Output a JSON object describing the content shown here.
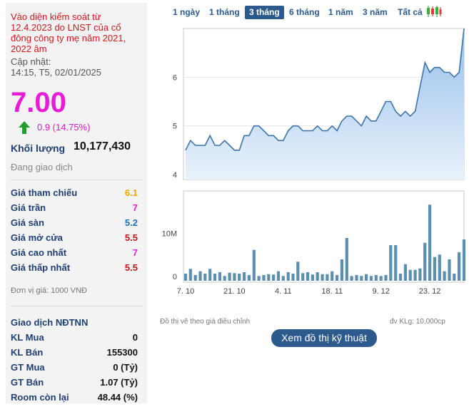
{
  "stock": {
    "warning": "Vào diện kiểm soát từ 12.4.2023 do LNST của cổ đông công ty mẹ năm 2021, 2022 âm",
    "update_label": "Cập nhật:",
    "update_time": "14:15, T5, 02/01/2025",
    "price": "7.00",
    "change": "0.9 (14.75%)",
    "volume_label": "Khối lượng",
    "volume": "10,177,430",
    "status": "Đang giao dịch",
    "colors": {
      "price": "#e81bd6",
      "up": "#1fa02a",
      "ref": "#f0a500",
      "ceil": "#e81bd6",
      "floor": "#1d6fb0",
      "down": "#c0171c"
    }
  },
  "prices": [
    {
      "label": "Giá tham chiếu",
      "value": "6.1",
      "color": "#f0a500"
    },
    {
      "label": "Giá trần",
      "value": "7",
      "color": "#e81bd6"
    },
    {
      "label": "Giá sàn",
      "value": "5.2",
      "color": "#1d6fb0"
    },
    {
      "label": "Giá mở cửa",
      "value": "5.5",
      "color": "#c0171c"
    },
    {
      "label": "Giá cao nhất",
      "value": "7",
      "color": "#e81bd6"
    },
    {
      "label": "Giá thấp nhất",
      "value": "5.5",
      "color": "#c0171c"
    }
  ],
  "unit_note": "Đơn vị giá: 1000 VNĐ",
  "foreign": {
    "title": "Giao dịch NĐTNN",
    "rows": [
      {
        "label": "KL Mua",
        "value": "0"
      },
      {
        "label": "KL Bán",
        "value": "155300"
      },
      {
        "label": "GT Mua",
        "value": "0 (Tỷ)"
      },
      {
        "label": "GT Bán",
        "value": "1.07 (Tỷ)"
      },
      {
        "label": "Room còn lại",
        "value": "48.44 (%)"
      }
    ]
  },
  "tabs": [
    "1 ngày",
    "1 tháng",
    "3 tháng",
    "6 tháng",
    "1 năm",
    "3 năm",
    "Tất cả"
  ],
  "active_tab": 2,
  "chart_note": "Đồ thị vẽ theo giá điều chỉnh",
  "volume_unit_note": "đv KLg: 10,000cp",
  "tech_button": "Xem đồ thị kỹ thuật",
  "chart_data": {
    "type": "area",
    "price_axis": {
      "ticks": [
        "4",
        "5",
        "6"
      ],
      "ylim": [
        4,
        7
      ]
    },
    "volume_axis": {
      "ticks": [
        "0",
        "10M"
      ],
      "ylim": [
        0,
        18
      ]
    },
    "x_tick_labels": [
      "7. 10",
      "21. 10",
      "4. 11",
      "18. 11",
      "9. 12",
      "23. 12"
    ],
    "series": [
      {
        "values": [
          4.5,
          4.7,
          4.6,
          4.6,
          4.6,
          4.8,
          4.6,
          4.6,
          4.7,
          4.6,
          4.5,
          4.5,
          4.8,
          4.8,
          5.0,
          5.0,
          4.9,
          4.8,
          4.8,
          4.7,
          4.7,
          4.9,
          5.0,
          5.0,
          4.9,
          4.9,
          4.9,
          5.0,
          4.9,
          4.9,
          5.0,
          4.9,
          5.1,
          5.2,
          5.2,
          5.1,
          5.0,
          5.2,
          5.1,
          5.1,
          5.3,
          5.5,
          5.5,
          5.3,
          5.2,
          5.3,
          5.2,
          5.3,
          5.8,
          6.3,
          6.1,
          6.2,
          6.2,
          6.1,
          6.1,
          6.0,
          6.1,
          7.0
        ]
      },
      {
        "values": [
          1.5,
          2.5,
          1.2,
          2.0,
          1.5,
          2.5,
          1.5,
          1.8,
          1.0,
          1.7,
          1.6,
          1.5,
          1.8,
          1.2,
          6.5,
          1.0,
          1.2,
          1.4,
          1.3,
          2.0,
          1.0,
          1.8,
          1.5,
          4.0,
          1.6,
          1.8,
          1.3,
          1.8,
          1.4,
          1.4,
          2.0,
          1.2,
          4.5,
          9.0,
          1.0,
          1.2,
          1.0,
          1.4,
          1.0,
          1.2,
          1.0,
          1.2,
          7.5,
          7.5,
          1.5,
          3.5,
          2.3,
          2.3,
          2.6,
          8.0,
          16.0,
          5.0,
          5.5,
          2.0,
          4.5,
          1.5,
          6.0,
          8.7
        ]
      }
    ]
  }
}
